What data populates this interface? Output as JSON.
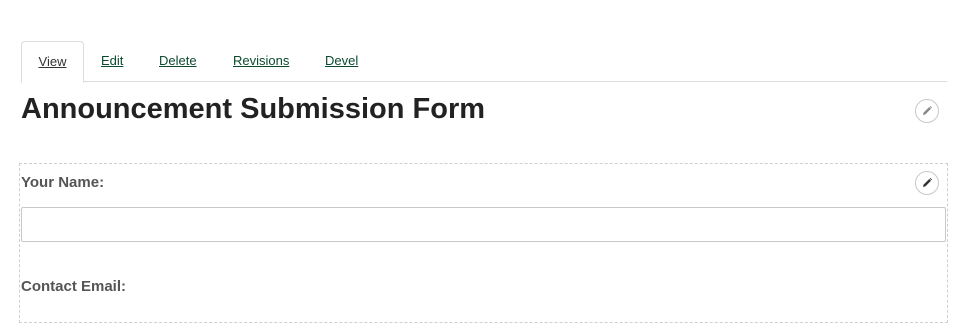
{
  "tabs": [
    {
      "label": "View",
      "active": true
    },
    {
      "label": "Edit"
    },
    {
      "label": "Delete"
    },
    {
      "label": "Revisions"
    },
    {
      "label": "Devel"
    }
  ],
  "page": {
    "title": "Announcement Submission Form"
  },
  "form": {
    "name_label": "Your Name:",
    "name_value": "",
    "email_label": "Contact Email:"
  },
  "icons": {
    "title_edit": "pencil-icon",
    "form_edit": "pencil-icon"
  },
  "colors": {
    "link": "#0b4a2f",
    "title": "#222222",
    "label": "#555555",
    "border": "#dcdcdc"
  }
}
